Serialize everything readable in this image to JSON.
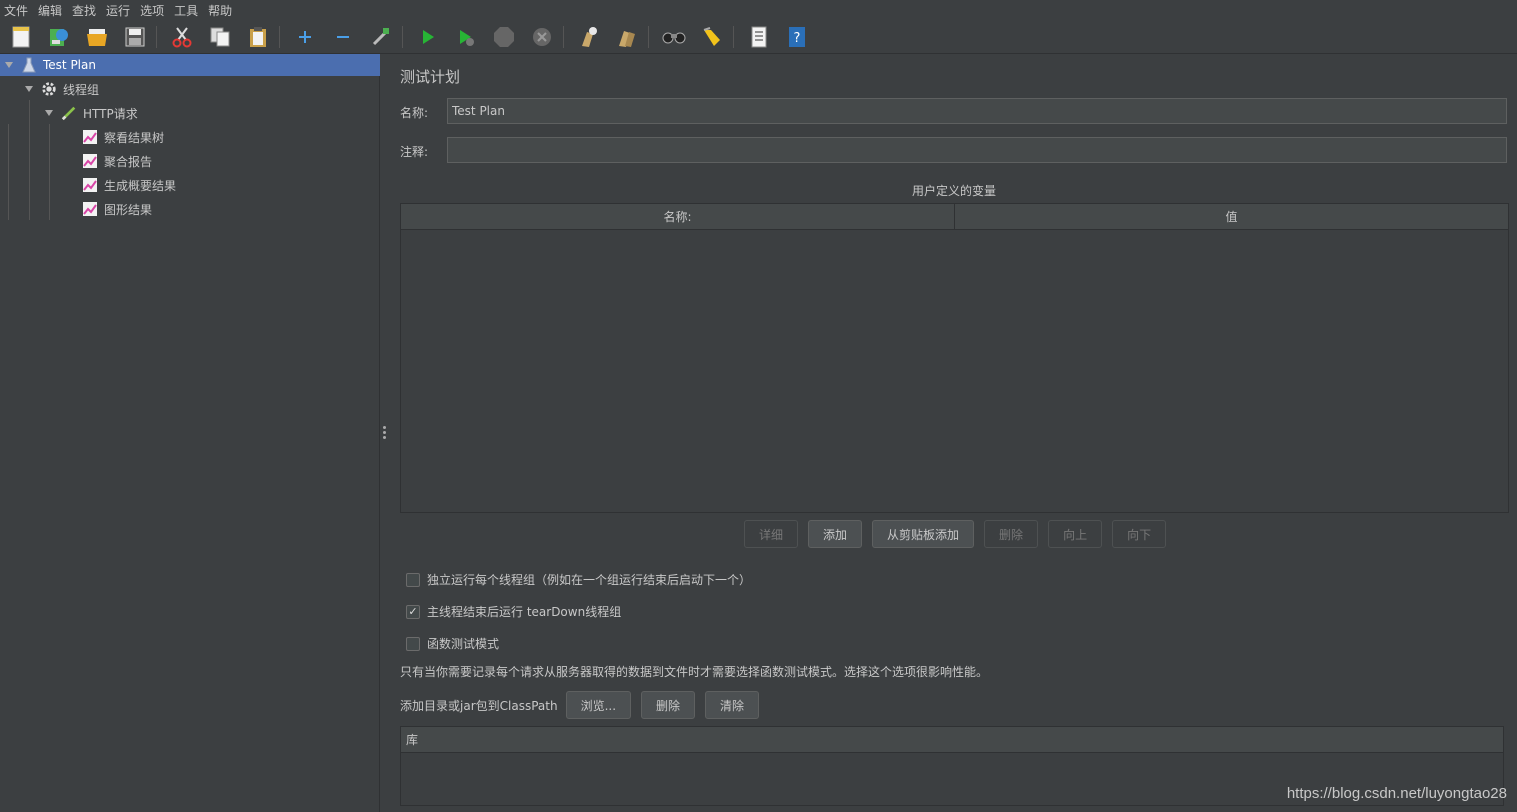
{
  "menu": [
    "文件",
    "编辑",
    "查找",
    "运行",
    "选项",
    "工具",
    "帮助"
  ],
  "toolbar_icons": [
    "new-icon",
    "templates-icon",
    "open-icon",
    "save-icon",
    "cut-icon",
    "copy-icon",
    "paste-icon",
    "expand-icon",
    "collapse-icon",
    "toggle-icon",
    "start-icon",
    "start-no-pause-icon",
    "stop-icon",
    "shutdown-icon",
    "clear-icon",
    "clear-all-icon",
    "search-icon",
    "reset-search-icon",
    "function-helper-icon",
    "help-icon"
  ],
  "tree": {
    "test_plan": "Test Plan",
    "thread_group": "线程组",
    "http_request": "HTTP请求",
    "listeners": [
      "察看结果树",
      "聚合报告",
      "生成概要结果",
      "图形结果"
    ]
  },
  "panel": {
    "title": "测试计划",
    "name_label": "名称:",
    "name_value": "Test Plan",
    "comment_label": "注释:",
    "comment_value": "",
    "vars_caption": "用户定义的变量",
    "vars_columns": [
      "名称:",
      "值"
    ],
    "buttons": {
      "detail": "详细",
      "add": "添加",
      "add_clipboard": "从剪贴板添加",
      "delete": "删除",
      "up": "向上",
      "down": "向下"
    },
    "options": {
      "serialize": "独立运行每个线程组（例如在一个组运行结束后启动下一个）",
      "serialize_checked": false,
      "teardown": "主线程结束后运行 tearDown线程组",
      "teardown_checked": true,
      "functional": "函数测试模式",
      "functional_checked": false
    },
    "hint": "只有当你需要记录每个请求从服务器取得的数据到文件时才需要选择函数测试模式。选择这个选项很影响性能。",
    "classpath_label": "添加目录或jar包到ClassPath",
    "browse": "浏览...",
    "cp_delete": "删除",
    "cp_clear": "清除",
    "lib_column": "库"
  },
  "watermark": "https://blog.csdn.net/luyongtao28",
  "colors": {
    "background": "#3c3f41",
    "selection": "#4b6eaf",
    "field": "#45494a"
  }
}
